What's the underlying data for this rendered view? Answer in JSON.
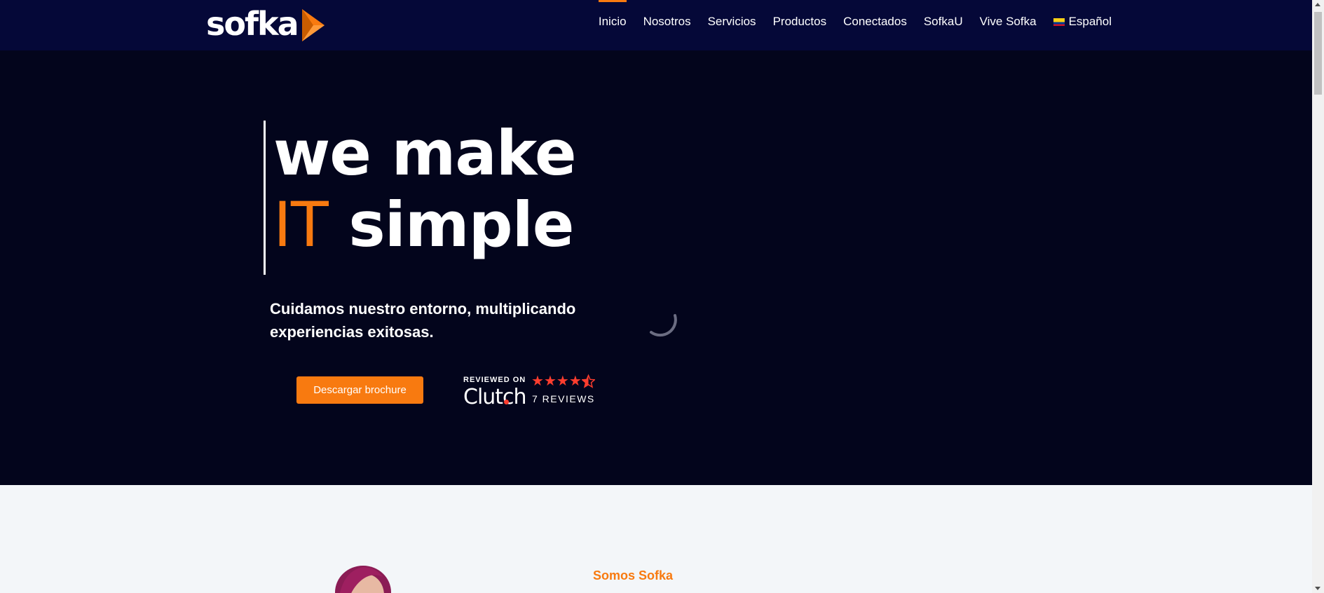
{
  "header": {
    "logo_text": "sofka",
    "nav": [
      {
        "label": "Inicio",
        "active": true
      },
      {
        "label": "Nosotros"
      },
      {
        "label": "Servicios"
      },
      {
        "label": "Productos"
      },
      {
        "label": "Conectados"
      },
      {
        "label": "SofkaU"
      },
      {
        "label": "Vive Sofka"
      },
      {
        "label": "Español",
        "icon": "colombia-flag-icon"
      }
    ]
  },
  "hero": {
    "headline_line1": "we make",
    "headline_accent": "IT",
    "headline_line2_rest": " simple",
    "subtitle": "Cuidamos nuestro entorno, multiplicando experiencias exitosas.",
    "cta_label": "Descargar brochure",
    "clutch": {
      "reviewed_on": "REVIEWED ON",
      "logo_text": "Clutch",
      "rating_stars": 4.5,
      "reviews": "7 REVIEWS"
    },
    "loading_icon": "spinner-icon"
  },
  "about": {
    "section_title": "Somos Sofka"
  },
  "colors": {
    "header_bg": "#050838",
    "hero_bg": "#03051c",
    "accent": "#f87a10",
    "page_bg": "#f3f6f9",
    "star": "#ff3d2e"
  }
}
